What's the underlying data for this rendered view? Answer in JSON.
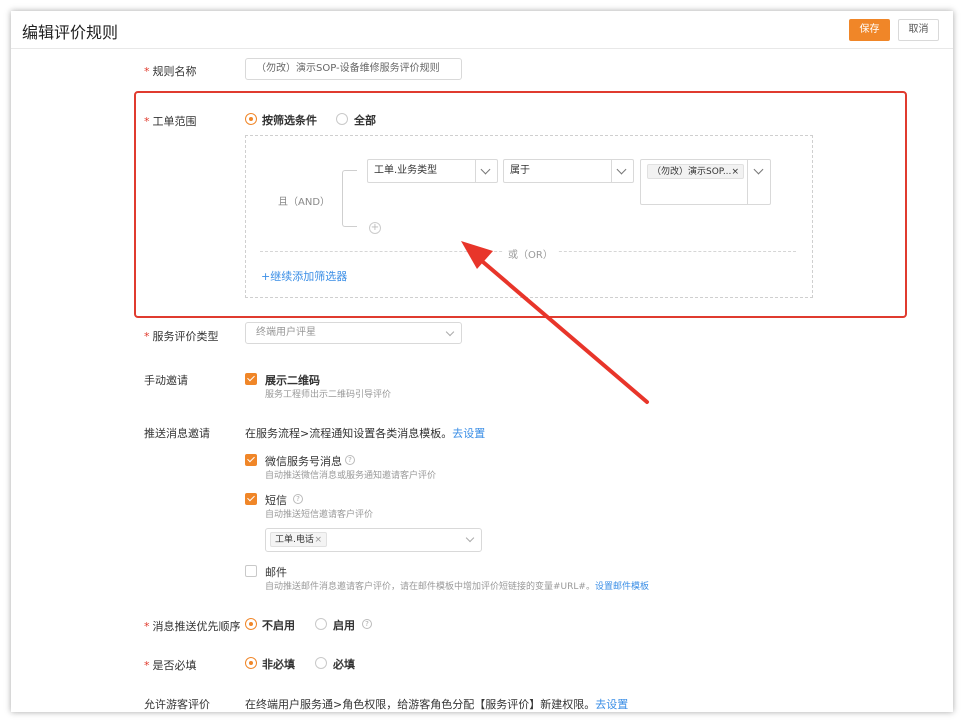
{
  "page": {
    "title": "编辑评价规则"
  },
  "toolbar": {
    "save_label": "保存",
    "cancel_label": "取消"
  },
  "form": {
    "rule_name": {
      "label": "规则名称",
      "value": "（勿改）演示SOP-设备维修服务评价规则"
    },
    "scope": {
      "label": "工单范围",
      "options": [
        "按筛选条件",
        "全部"
      ],
      "selected": "按筛选条件",
      "and_label": "且（AND）",
      "or_label": "或（OR）",
      "condition": {
        "field": "工单.业务类型",
        "operator": "属于",
        "value_tag": "（勿改）演示SOP..."
      },
      "add_filter_label": "+继续添加筛选器"
    },
    "eval_type": {
      "label": "服务评价类型",
      "placeholder": "终端用户评星"
    },
    "manual_invite": {
      "label": "手动邀请",
      "option_label": "展示二维码",
      "option_desc": "服务工程师出示二维码引导评价",
      "checked": true
    },
    "push_invite": {
      "label": "推送消息邀请",
      "intro": "在服务流程>流程通知设置各类消息模板。",
      "intro_link": "去设置",
      "wechat": {
        "label": "微信服务号消息",
        "desc": "自动推送微信消息或服务通知邀请客户评价",
        "checked": true
      },
      "sms": {
        "label": "短信",
        "desc": "自动推送短信邀请客户评价",
        "checked": true,
        "field_tag": "工单.电话"
      },
      "email": {
        "label": "邮件",
        "desc": "自动推送邮件消息邀请客户评价，请在邮件模板中增加评价短链接的变量#URL#。",
        "desc_link": "设置邮件模板",
        "checked": false
      }
    },
    "priority": {
      "label": "消息推送优先顺序",
      "options": [
        "不启用",
        "启用"
      ],
      "selected": "不启用"
    },
    "required": {
      "label": "是否必填",
      "options": [
        "非必填",
        "必填"
      ],
      "selected": "非必填"
    },
    "guest": {
      "label": "允许游客评价",
      "text": "在终端用户服务通>角色权限，给游客角色分配【服务评价】新建权限。",
      "link": "去设置"
    }
  },
  "colors": {
    "accent": "#f08628",
    "annotation_red": "#e03b2f",
    "link": "#3a8ee6"
  },
  "icons": {
    "close": "×",
    "help": "?",
    "add": "+"
  }
}
